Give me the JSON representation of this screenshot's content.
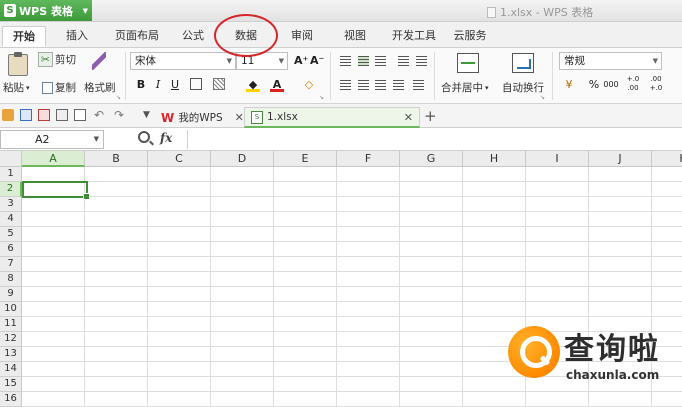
{
  "app": {
    "name": "WPS 表格",
    "logo_letter": "S",
    "window_title": "1.xlsx - WPS 表格"
  },
  "ribbon_tabs": [
    {
      "label": "开始",
      "active": true
    },
    {
      "label": "插入"
    },
    {
      "label": "页面布局"
    },
    {
      "label": "公式"
    },
    {
      "label": "数据",
      "highlighted": true
    },
    {
      "label": "审阅"
    },
    {
      "label": "视图"
    },
    {
      "label": "开发工具"
    },
    {
      "label": "云服务"
    }
  ],
  "ribbon": {
    "paste": "粘贴",
    "cut": "剪切",
    "copy": "复制",
    "format_painter": "格式刷",
    "font_name": "宋体",
    "font_size": "11",
    "grow_font": "A⁺",
    "shrink_font": "A⁻",
    "bold": "B",
    "italic": "I",
    "underline": "U",
    "font_color_letter": "A",
    "merge_center": "合并居中",
    "wrap_text": "自动换行",
    "number_format": "常规",
    "percent": "%",
    "thousands": "000",
    "inc_decimal": "+.0 .00",
    "dec_decimal": ".00 +.0"
  },
  "doc_tabs": [
    {
      "label": "我的WPS",
      "logo": "W"
    },
    {
      "label": "1.xlsx",
      "active": true
    }
  ],
  "formula_bar": {
    "cell_ref": "A2",
    "fx": "fx",
    "value": ""
  },
  "columns": [
    "A",
    "B",
    "C",
    "D",
    "E",
    "F",
    "G",
    "H",
    "I",
    "J",
    "K"
  ],
  "rows": [
    "1",
    "2",
    "3",
    "4",
    "5",
    "6",
    "7",
    "8",
    "9",
    "10",
    "11",
    "12",
    "13",
    "14",
    "15",
    "16"
  ],
  "selection": {
    "column": "A",
    "row": "2"
  },
  "watermark": {
    "text": "查询啦",
    "url": "chaxunla.com"
  },
  "colors": {
    "brand_green": "#3d9a3a",
    "annotation_red": "#d6262b",
    "watermark_orange": "#ff8a00"
  }
}
